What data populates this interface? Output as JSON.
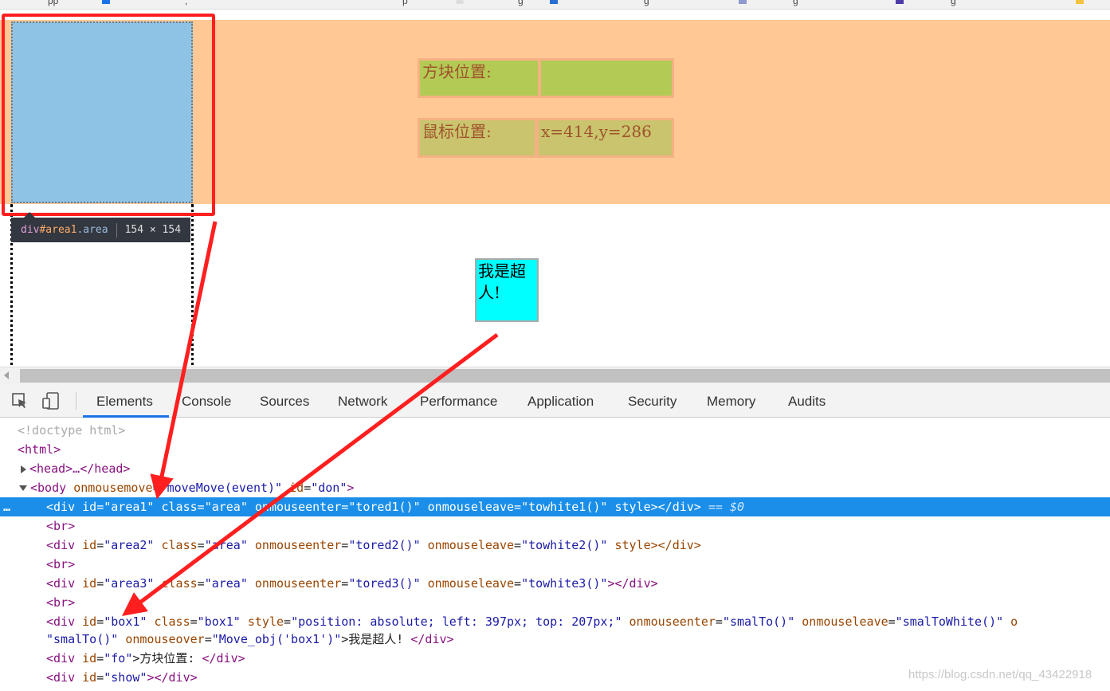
{
  "tabstrip": {
    "items": [
      "pp",
      ",",
      "p",
      "g",
      "g",
      "g",
      "g"
    ]
  },
  "page": {
    "fo_label": "方块位置:",
    "fo_value": "",
    "mouse_label": "鼠标位置:",
    "mouse_value": "x=414,y=286",
    "box1_text": "我是超人!",
    "tooltip": {
      "tag": "div",
      "id": "#area1",
      "class": ".area",
      "size": "154 × 154"
    }
  },
  "devtools": {
    "tabs": [
      "Elements",
      "Console",
      "Sources",
      "Network",
      "Performance",
      "Application",
      "Security",
      "Memory",
      "Audits"
    ],
    "active_tab": "Elements",
    "lines": {
      "doctype": "<!doctype html>",
      "html_open": "<html>",
      "head_collapsed": "<head>…</head>",
      "body_open_tag": "<body",
      "body_attr1": "onmousemove",
      "body_val1": "\"moveMove(event)\"",
      "body_attr2": "id",
      "body_val2": "\"don\"",
      "div1": {
        "id": "\"area1\"",
        "class": "\"area\"",
        "enter": "\"tored1()\"",
        "leave": "\"towhite1()\"",
        "tail": "style></div>",
        "eq": "== $0"
      },
      "br": "<br>",
      "div2": {
        "id": "\"area2\"",
        "class": "\"area\"",
        "enter": "\"tored2()\"",
        "leave": "\"towhite2()\"",
        "tail": "style></div>"
      },
      "div3": {
        "id": "\"area3\"",
        "class": "\"area\"",
        "enter": "\"tored3()\"",
        "leave": "\"towhite3()\"",
        "tail": "></div>"
      },
      "box": {
        "id": "\"box1\"",
        "class": "\"box1\"",
        "style": "\"position: absolute; left: 397px; top: 207px;\"",
        "enter": "\"smalTo()\"",
        "leave": "\"smalToWhite()\"",
        "cont": "o",
        "val_start": "\"smalTo()\"",
        "over_attr": "onmouseover",
        "over_val": "\"Move_obj('box1')\"",
        "text": ">我是超人! ",
        "close": "</div>"
      },
      "fo": {
        "id": "\"fo\"",
        "text": ">方块位置: ",
        "close": "</div>"
      },
      "show": {
        "id": "\"show\"",
        "close": "></div>"
      }
    }
  },
  "watermark": "https://blog.csdn.net/qq_43422918",
  "colors": {
    "orange_band": "#ffc894",
    "area_blue": "#8fc3e6",
    "highlight_red": "#ff1f1f",
    "selected_row": "#1a8ee8",
    "box_cyan": "#00ffff"
  }
}
